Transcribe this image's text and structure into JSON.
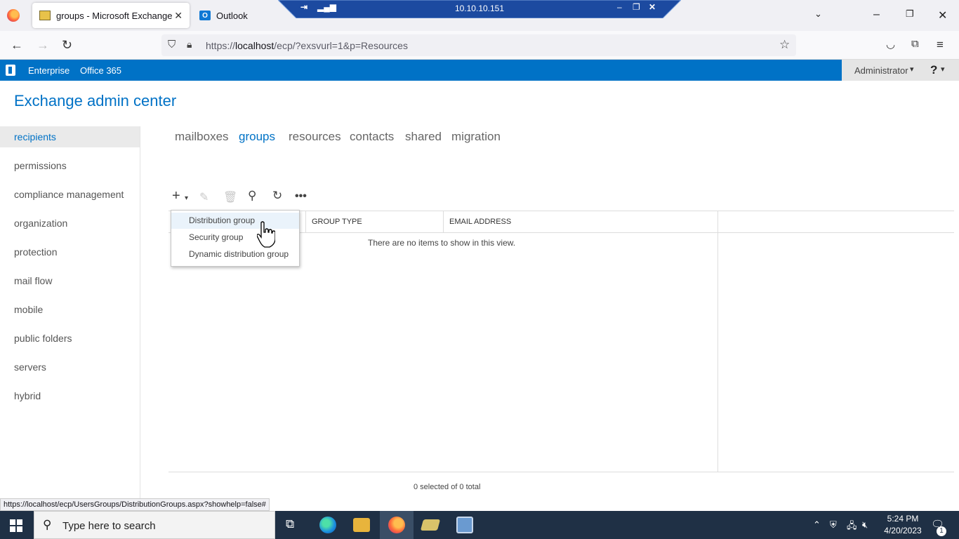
{
  "browser": {
    "active_tab_title": "groups - Microsoft Exchange",
    "inactive_tab_title": "Outlook",
    "url_prefix": "https://",
    "url_host": "localhost",
    "url_path": "/ecp/?exsvurl=1&p=Resources",
    "status_link": "https://localhost/ecp/UsersGroups/DistributionGroups.aspx?showhelp=false#"
  },
  "rdp": {
    "host": "10.10.10.151"
  },
  "header": {
    "enterprise_label": "Enterprise",
    "office365_label": "Office 365",
    "admin_label": "Administrator",
    "help_label": "?",
    "app_title": "Exchange admin center"
  },
  "sidebar": {
    "items": [
      {
        "label": "recipients",
        "active": true
      },
      {
        "label": "permissions"
      },
      {
        "label": "compliance management"
      },
      {
        "label": "organization"
      },
      {
        "label": "protection"
      },
      {
        "label": "mail flow"
      },
      {
        "label": "mobile"
      },
      {
        "label": "public folders"
      },
      {
        "label": "servers"
      },
      {
        "label": "hybrid"
      }
    ]
  },
  "tabs": [
    {
      "label": "mailboxes"
    },
    {
      "label": "groups",
      "active": true
    },
    {
      "label": "resources"
    },
    {
      "label": "contacts"
    },
    {
      "label": "shared"
    },
    {
      "label": "migration"
    }
  ],
  "toolbar": {
    "icons": [
      "add-icon",
      "edit-icon",
      "delete-icon",
      "search-icon",
      "refresh-icon",
      "more-icon"
    ]
  },
  "grid": {
    "columns": [
      "GROUP TYPE",
      "EMAIL ADDRESS"
    ],
    "empty_message": "There are no items to show in this view.",
    "footer": "0 selected of 0 total"
  },
  "new_menu": {
    "items": [
      "Distribution group",
      "Security group",
      "Dynamic distribution group"
    ],
    "highlighted": "Distribution group"
  },
  "taskbar": {
    "search_placeholder": "Type here to search",
    "time": "5:24 PM",
    "date": "4/20/2023",
    "notification_count": "1"
  },
  "colors": {
    "accent": "#0072c6",
    "taskbar": "#1f3045",
    "rdp_bar": "#1c4aa0"
  }
}
